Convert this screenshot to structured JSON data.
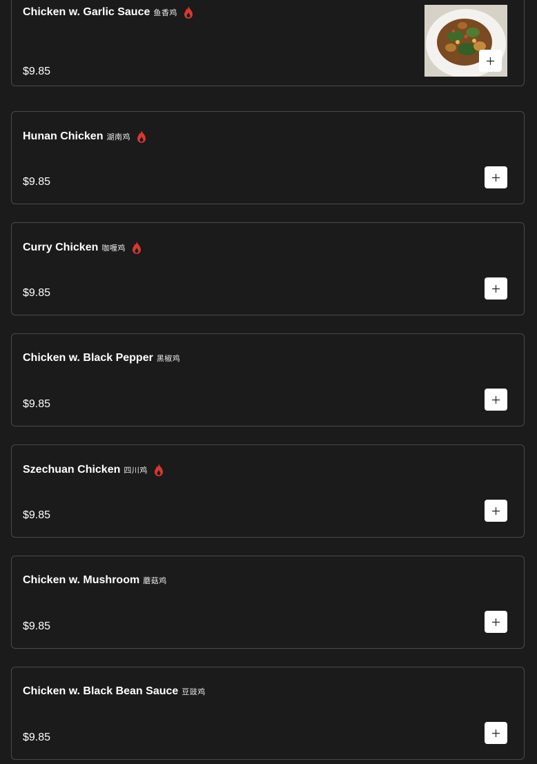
{
  "colors": {
    "background": "#1b1b1b",
    "card_border": "#4a4a4a",
    "spicy": "#d9382f",
    "add_button_bg": "#ffffff"
  },
  "icons": {
    "spicy": "flame-icon",
    "add": "plus-icon"
  },
  "items": [
    {
      "name": "Chicken w. Garlic Sauce",
      "cjk": "鱼香鸡",
      "price": "$9.85",
      "spicy": true,
      "image": "chicken-garlic-sauce-photo"
    },
    {
      "name": "Hunan Chicken",
      "cjk": "湖南鸡",
      "price": "$9.85",
      "spicy": true
    },
    {
      "name": "Curry Chicken",
      "cjk": "咖喱鸡",
      "price": "$9.85",
      "spicy": true
    },
    {
      "name": "Chicken w. Black Pepper",
      "cjk": "黑椒鸡",
      "price": "$9.85",
      "spicy": false
    },
    {
      "name": "Szechuan Chicken",
      "cjk": "四川鸡",
      "price": "$9.85",
      "spicy": true
    },
    {
      "name": "Chicken w. Mushroom",
      "cjk": "蘑菇鸡",
      "price": "$9.85",
      "spicy": false
    },
    {
      "name": "Chicken w. Black Bean Sauce",
      "cjk": "豆豉鸡",
      "price": "$9.85",
      "spicy": false
    }
  ]
}
